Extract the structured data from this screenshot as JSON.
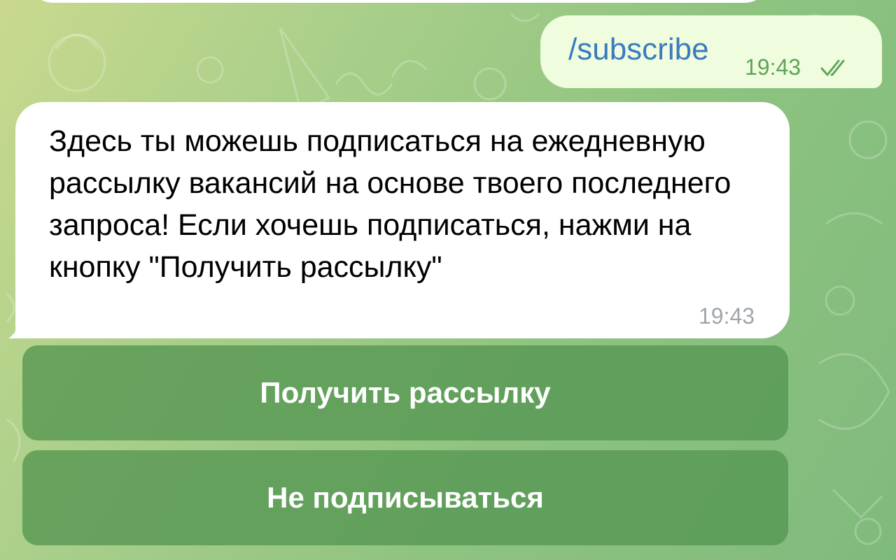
{
  "chat": {
    "outgoing_message": {
      "text": "/subscribe",
      "time": "19:43",
      "status_icon": "double-check-icon"
    },
    "incoming_message": {
      "text": "Здесь ты можешь подписаться на ежедневную рассылку вакансий на основе твоего последнего запроса! Если хочешь подписаться, нажми на кнопку \"Получить рассылку\"",
      "time": "19:43"
    },
    "inline_buttons": [
      {
        "label": "Получить рассылку"
      },
      {
        "label": "Не подписываться"
      }
    ]
  },
  "colors": {
    "outgoing_bubble": "#effdde",
    "incoming_bubble": "#ffffff",
    "command_link": "#3a7bbf",
    "outgoing_time": "#5fa35a",
    "incoming_time": "#a0a6ab",
    "button_bg": "#549652"
  }
}
